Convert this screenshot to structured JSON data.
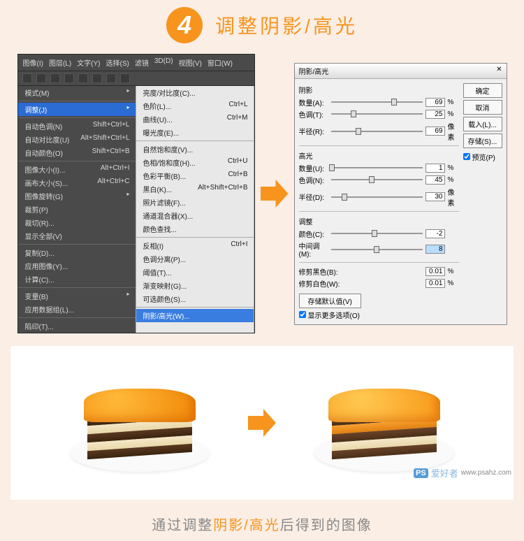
{
  "step": "4",
  "title": "调整阴影/高光",
  "menubar": [
    "图像(I)",
    "图层(L)",
    "文字(Y)",
    "选择(S)",
    "滤镜",
    "3D(D)",
    "视图(V)",
    "窗口(W)"
  ],
  "col1": {
    "groups": [
      [
        {
          "label": "模式(M)",
          "arrow": true
        }
      ],
      [
        {
          "label": "调整(J)",
          "arrow": true,
          "hl": true
        }
      ],
      [
        {
          "label": "自动色调(N)",
          "short": "Shift+Ctrl+L"
        },
        {
          "label": "自动对比度(U)",
          "short": "Alt+Shift+Ctrl+L"
        },
        {
          "label": "自动颜色(O)",
          "short": "Shift+Ctrl+B"
        }
      ],
      [
        {
          "label": "图像大小(I)...",
          "short": "Alt+Ctrl+I"
        },
        {
          "label": "画布大小(S)...",
          "short": "Alt+Ctrl+C"
        },
        {
          "label": "图像旋转(G)",
          "arrow": true
        },
        {
          "label": "裁剪(P)"
        },
        {
          "label": "裁切(R)..."
        },
        {
          "label": "显示全部(V)"
        }
      ],
      [
        {
          "label": "复制(D)..."
        },
        {
          "label": "应用图像(Y)..."
        },
        {
          "label": "计算(C)..."
        }
      ],
      [
        {
          "label": "变量(B)",
          "arrow": true
        },
        {
          "label": "应用数据组(L)..."
        }
      ],
      [
        {
          "label": "陷印(T)..."
        }
      ]
    ]
  },
  "col2": {
    "groups": [
      [
        {
          "label": "亮度/对比度(C)..."
        },
        {
          "label": "色阶(L)...",
          "short": "Ctrl+L"
        },
        {
          "label": "曲线(U)...",
          "short": "Ctrl+M"
        },
        {
          "label": "曝光度(E)..."
        }
      ],
      [
        {
          "label": "自然饱和度(V)..."
        },
        {
          "label": "色相/饱和度(H)...",
          "short": "Ctrl+U"
        },
        {
          "label": "色彩平衡(B)...",
          "short": "Ctrl+B"
        },
        {
          "label": "黑白(K)...",
          "short": "Alt+Shift+Ctrl+B"
        },
        {
          "label": "照片滤镜(F)..."
        },
        {
          "label": "通道混合器(X)..."
        },
        {
          "label": "颜色查找..."
        }
      ],
      [
        {
          "label": "反相(I)",
          "short": "Ctrl+I"
        },
        {
          "label": "色调分离(P)..."
        },
        {
          "label": "阈值(T)..."
        },
        {
          "label": "渐变映射(G)..."
        },
        {
          "label": "可选颜色(S)..."
        }
      ],
      [
        {
          "label": "阴影/高光(W)...",
          "hl": true
        }
      ]
    ]
  },
  "dialog": {
    "title": "阴影/高光",
    "buttons": [
      "确定",
      "取消",
      "载入(L)...",
      "存储(S)..."
    ],
    "preview": "预览(P)",
    "sections": [
      {
        "label": "阴影",
        "rows": [
          {
            "lbl": "数量(A):",
            "val": "69",
            "unit": "%",
            "pos": 69
          },
          {
            "lbl": "色调(T):",
            "val": "25",
            "unit": "%",
            "pos": 25
          },
          {
            "lbl": "半径(R):",
            "val": "69",
            "unit": "像素",
            "pos": 30
          }
        ]
      },
      {
        "label": "高光",
        "rows": [
          {
            "lbl": "数量(U):",
            "val": "1",
            "unit": "%",
            "pos": 1
          },
          {
            "lbl": "色调(N):",
            "val": "45",
            "unit": "%",
            "pos": 45
          },
          {
            "lbl": "半径(D):",
            "val": "30",
            "unit": "像素",
            "pos": 15
          }
        ]
      },
      {
        "label": "调整",
        "rows": [
          {
            "lbl": "颜色(C):",
            "val": "-2",
            "unit": "",
            "pos": 48
          },
          {
            "lbl": "中间调(M):",
            "val": "8",
            "unit": "",
            "pos": 50,
            "hl": true
          }
        ]
      }
    ],
    "clips": [
      {
        "lbl": "修剪黑色(B):",
        "val": "0.01",
        "unit": "%"
      },
      {
        "lbl": "修剪白色(W):",
        "val": "0.01",
        "unit": "%"
      }
    ],
    "save_default": "存储默认值(V)",
    "show_more": "显示更多选项(O)"
  },
  "caption": {
    "pre": "通过调整",
    "em": "阴影/高光",
    "post": "后得到的图像"
  },
  "watermark": {
    "brand": "PS",
    "name": "爱好者",
    "url": "www.psahz.com"
  }
}
